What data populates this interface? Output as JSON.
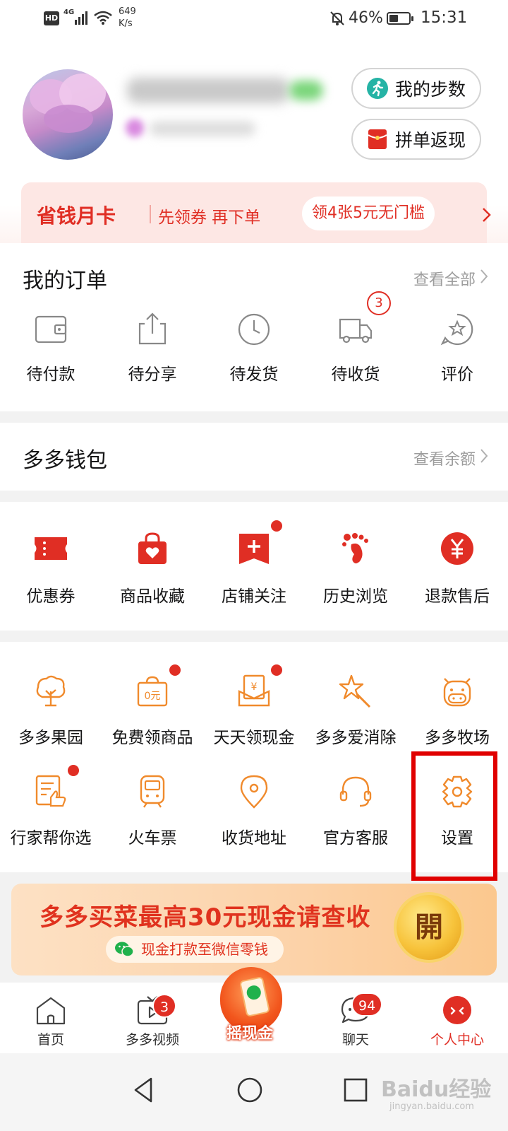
{
  "status_bar": {
    "hd": "HD",
    "network": "4G",
    "speed_value": "649",
    "speed_unit": "K/s",
    "battery": "46%",
    "battery_level": 0.46,
    "time": "15:31"
  },
  "profile": {
    "buttons": {
      "steps": "我的步数",
      "cashback": "拼单返现"
    }
  },
  "vip_banner": {
    "title": "省钱月卡",
    "subtitle": "先领券 再下单",
    "chip": "领4张5元无门槛"
  },
  "orders": {
    "title": "我的订单",
    "link": "查看全部",
    "items": [
      {
        "label": "待付款",
        "icon": "wallet-icon"
      },
      {
        "label": "待分享",
        "icon": "share-icon"
      },
      {
        "label": "待发货",
        "icon": "clock-icon"
      },
      {
        "label": "待收货",
        "icon": "truck-icon",
        "badge": "3"
      },
      {
        "label": "评价",
        "icon": "review-icon"
      }
    ]
  },
  "wallet": {
    "title": "多多钱包",
    "link": "查看余额"
  },
  "shortcuts": {
    "items": [
      {
        "label": "优惠券",
        "icon": "coupon-icon"
      },
      {
        "label": "商品收藏",
        "icon": "favorite-bag-icon"
      },
      {
        "label": "店铺关注",
        "icon": "shop-follow-icon",
        "dot": true
      },
      {
        "label": "历史浏览",
        "icon": "footprint-icon"
      },
      {
        "label": "退款售后",
        "icon": "refund-icon"
      }
    ]
  },
  "services": {
    "row1": [
      {
        "label": "多多果园",
        "icon": "tree-icon"
      },
      {
        "label": "免费领商品",
        "icon": "free-bag-icon",
        "dot": true
      },
      {
        "label": "天天领现金",
        "icon": "cash-envelope-icon",
        "dot": true
      },
      {
        "label": "多多爱消除",
        "icon": "star-wand-icon"
      },
      {
        "label": "多多牧场",
        "icon": "cow-icon"
      }
    ],
    "row2": [
      {
        "label": "行家帮你选",
        "icon": "thumb-list-icon",
        "dot": true
      },
      {
        "label": "火车票",
        "icon": "train-icon"
      },
      {
        "label": "收货地址",
        "icon": "location-pin-icon"
      },
      {
        "label": "官方客服",
        "icon": "headset-icon"
      },
      {
        "label": "设置",
        "icon": "gear-icon"
      }
    ]
  },
  "promo": {
    "title": "多多买菜最高30元现金请查收",
    "subtitle": "现金打款至微信零钱",
    "coin": "開"
  },
  "tabbar": {
    "tabs": [
      {
        "label": "首页",
        "icon": "home-icon"
      },
      {
        "label": "多多视频",
        "icon": "video-icon",
        "badge": "3"
      },
      {
        "label": "摇现金",
        "icon": "shake-cash-icon"
      },
      {
        "label": "聊天",
        "icon": "chat-icon",
        "badge": "94"
      },
      {
        "label": "个人中心",
        "icon": "profile-icon"
      }
    ]
  },
  "colors": {
    "brand_red": "#e02e24",
    "service_orange": "#f08a2c",
    "highlight": "#e00000"
  },
  "watermark": {
    "main": "Baidu经验",
    "sub": "jingyan.baidu.com"
  }
}
